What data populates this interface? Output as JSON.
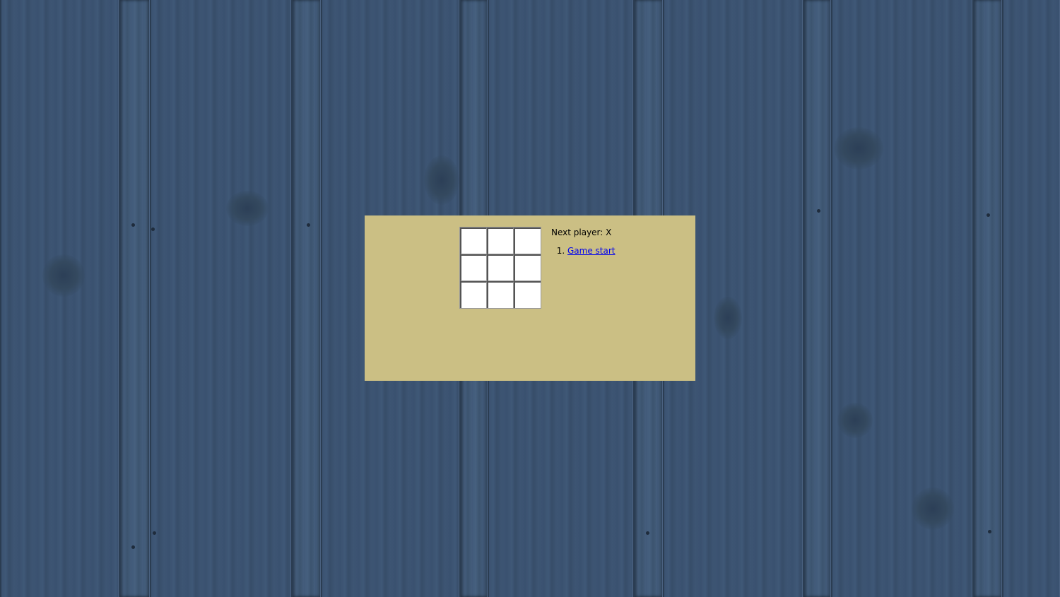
{
  "background": {
    "description_icon": "wood-plank-background",
    "colors": {
      "wood": "#3a5069",
      "panel": "#cbbf84",
      "link": "#0000ee"
    }
  },
  "game": {
    "board": {
      "squares": [
        "",
        "",
        "",
        "",
        "",
        "",
        "",
        "",
        ""
      ]
    },
    "status": "Next player: X",
    "moves": [
      {
        "label": "Game start"
      }
    ]
  }
}
